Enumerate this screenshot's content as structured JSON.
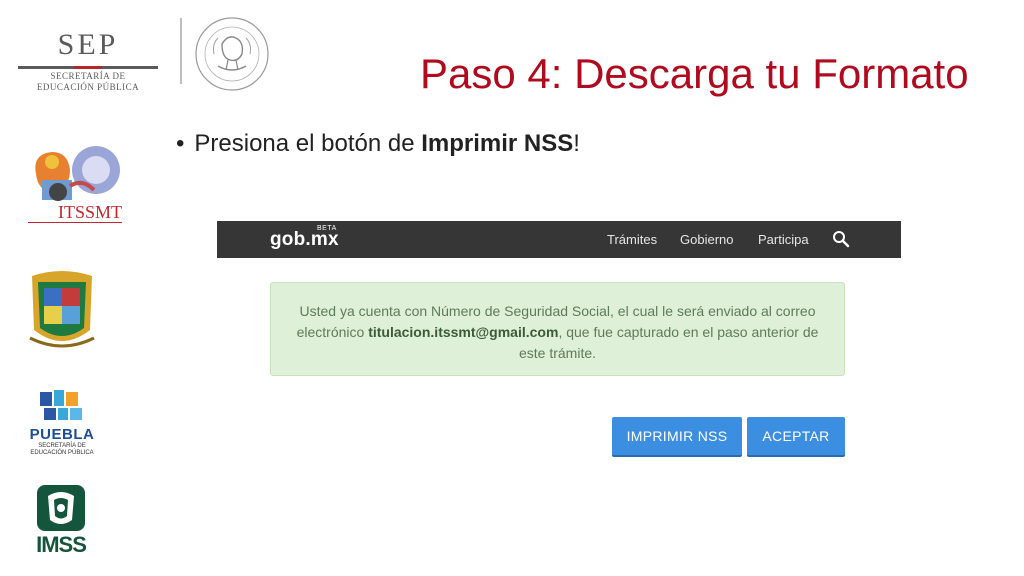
{
  "header": {
    "sep_word": "SEP",
    "sep_line1": "SECRETARÍA DE",
    "sep_line2": "EDUCACIÓN PÚBLICA",
    "title": "Paso 4: Descarga tu Formato"
  },
  "bullet": {
    "prefix": "Presiona el botón de ",
    "bold": "Imprimir NSS",
    "suffix": "!"
  },
  "side_logos": {
    "itssmt": "ITSSMT",
    "puebla_word": "PUEBLA",
    "puebla_line1": "SECRETARÍA DE",
    "puebla_line2": "EDUCACIÓN PÚBLICA",
    "imss": "IMSS"
  },
  "screenshot": {
    "nav": {
      "logo": "gob.mx",
      "beta": "BETA",
      "items": [
        "Trámites",
        "Gobierno",
        "Participa"
      ],
      "search_icon": "search-icon"
    },
    "alert": {
      "text_before": "Usted ya cuenta con Número de Seguridad Social, el cual le será enviado al correo electrónico ",
      "email": "titulacion.itssmt@gmail.com",
      "text_after": ", que fue capturado en el paso anterior de este trámite."
    },
    "buttons": {
      "print": "IMPRIMIR NSS",
      "accept": "ACEPTAR"
    }
  },
  "colors": {
    "title": "#b00a1e",
    "nav_bg": "#363636",
    "alert_bg": "#dff0d8",
    "button": "#3c8fe0"
  }
}
